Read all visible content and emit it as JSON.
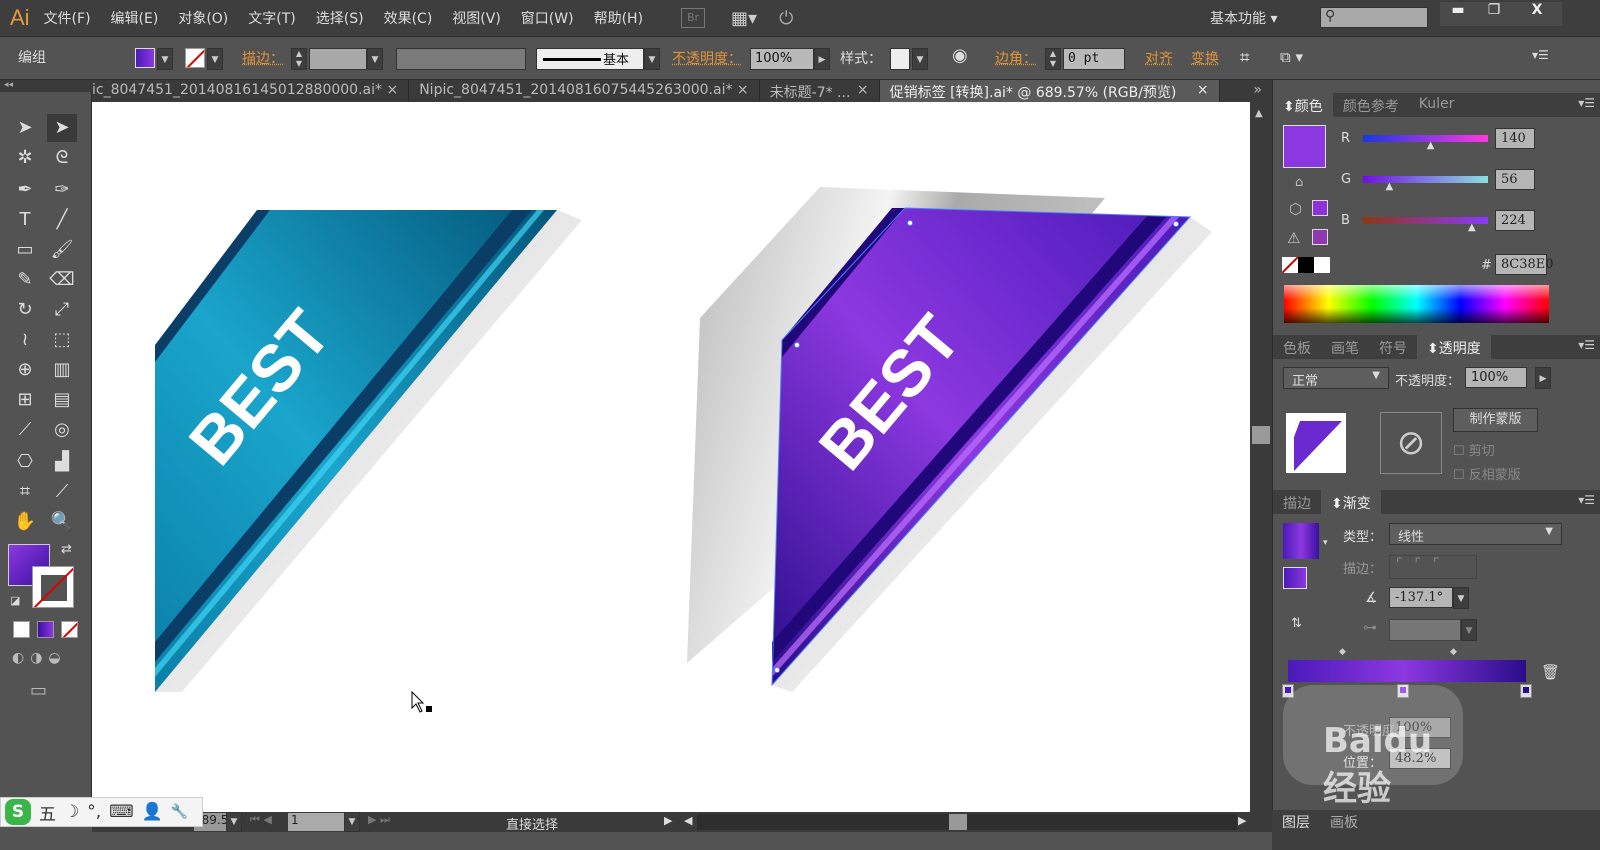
{
  "app": {
    "logo": "Ai",
    "workspace": "基本功能",
    "bridge": "Br"
  },
  "menu": [
    "文件(F)",
    "编辑(E)",
    "对象(O)",
    "文字(T)",
    "选择(S)",
    "效果(C)",
    "视图(V)",
    "窗口(W)",
    "帮助(H)"
  ],
  "window_controls": {
    "minimize": "▬",
    "restore": "❐",
    "close": "X"
  },
  "control_bar": {
    "selection": "编组",
    "stroke_label": "描边：",
    "stroke_style": "基本",
    "opacity_label": "不透明度：",
    "opacity_value": "100%",
    "style_label": "样式：",
    "corner_label": "边角：",
    "corner_value": "0 pt",
    "align_label": "对齐",
    "transform_label": "变换"
  },
  "tabs": [
    {
      "label": "ic_8047451_20140816145012880000.ai*",
      "active": false
    },
    {
      "label": "Nipic_8047451_20140816075445263000.ai*",
      "active": false
    },
    {
      "label": "未标题-7* ...",
      "active": false
    },
    {
      "label": "促销标签 [转换].ai* @ 689.57% (RGB/预览)",
      "active": true
    }
  ],
  "tab_close": "×",
  "tab_overflow": "»",
  "artwork": {
    "left_text": "BEST",
    "right_text": "BEST"
  },
  "color_panel": {
    "tabs": [
      "颜色",
      "颜色参考",
      "Kuler"
    ],
    "channels": [
      {
        "label": "R",
        "value": "140",
        "fraction": 0.55
      },
      {
        "label": "G",
        "value": "56",
        "fraction": 0.22
      },
      {
        "label": "B",
        "value": "224",
        "fraction": 0.88
      }
    ],
    "hex_label": "#",
    "hex": "8C38E0",
    "current_color": "#8c38e0"
  },
  "transparency_panel": {
    "tabs": [
      "色板",
      "画笔",
      "符号",
      "透明度"
    ],
    "blend_mode": "正常",
    "opacity_label": "不透明度：",
    "opacity_value": "100%",
    "make_mask": "制作蒙版",
    "clip": "剪切",
    "invert_mask": "反相蒙版"
  },
  "gradient_panel": {
    "tabs": [
      "描边",
      "渐变"
    ],
    "type_label": "类型：",
    "type_value": "线性",
    "stroke_label": "描边：",
    "angle_value": "-137.1°",
    "opacity_label": "不透明度：",
    "opacity_value": "100%",
    "location_label": "位置：",
    "location_value": "48.2%",
    "stops": [
      {
        "position": 0,
        "color": "#4a1ab8"
      },
      {
        "position": 48.2,
        "color": "#8c38e0"
      },
      {
        "position": 100,
        "color": "#2a0d8a"
      }
    ]
  },
  "bottom_panel": {
    "tabs": [
      "图层",
      "画板"
    ]
  },
  "status": {
    "zoom": "689.57",
    "page": "1",
    "tool": "直接选择"
  },
  "ime": {
    "mode": "五",
    "moon": "☽",
    "punct": "°,",
    "keyboard": "⌨",
    "wrench": "🔧"
  },
  "watermark": "Baidu 经验"
}
